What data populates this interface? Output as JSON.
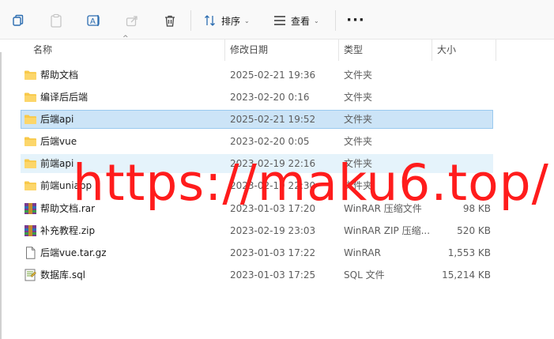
{
  "toolbar": {
    "sort_label": "排序",
    "view_label": "查看",
    "more_label": "···"
  },
  "columns": {
    "name": "名称",
    "date": "修改日期",
    "type": "类型",
    "size": "大小"
  },
  "files": [
    {
      "name": "帮助文档",
      "date": "2025-02-21 19:36",
      "type": "文件夹",
      "size": "",
      "icon": "folder-icon"
    },
    {
      "name": "编译后后端",
      "date": "2023-02-20 0:16",
      "type": "文件夹",
      "size": "",
      "icon": "folder-icon"
    },
    {
      "name": "后端api",
      "date": "2025-02-21 19:52",
      "type": "文件夹",
      "size": "",
      "icon": "folder-icon"
    },
    {
      "name": "后端vue",
      "date": "2023-02-20 0:05",
      "type": "文件夹",
      "size": "",
      "icon": "folder-icon"
    },
    {
      "name": "前端api",
      "date": "2023-02-19 22:16",
      "type": "文件夹",
      "size": "",
      "icon": "folder-icon"
    },
    {
      "name": "前端uniapp",
      "date": "2023-02-19 22:30",
      "type": "文件夹",
      "size": "",
      "icon": "folder-icon"
    },
    {
      "name": "帮助文档.rar",
      "date": "2023-01-03 17:20",
      "type": "WinRAR 压缩文件",
      "size": "98 KB",
      "icon": "rar-archive-icon"
    },
    {
      "name": "补充教程.zip",
      "date": "2023-02-19 23:03",
      "type": "WinRAR ZIP 压缩...",
      "size": "520 KB",
      "icon": "zip-archive-icon"
    },
    {
      "name": "后端vue.tar.gz",
      "date": "2023-01-03 17:22",
      "type": "WinRAR",
      "size": "1,553 KB",
      "icon": "file-icon"
    },
    {
      "name": "数据库.sql",
      "date": "2023-01-03 17:25",
      "type": "SQL 文件",
      "size": "15,214 KB",
      "icon": "sql-file-icon"
    }
  ],
  "selected_index": 2,
  "hover_index": 4,
  "watermark": "https://maku6.top/",
  "colors": {
    "selection": "#cce4f7",
    "hover": "#e5f3fb",
    "folder": "#f8c94a",
    "watermark": "#ff1c1c"
  }
}
